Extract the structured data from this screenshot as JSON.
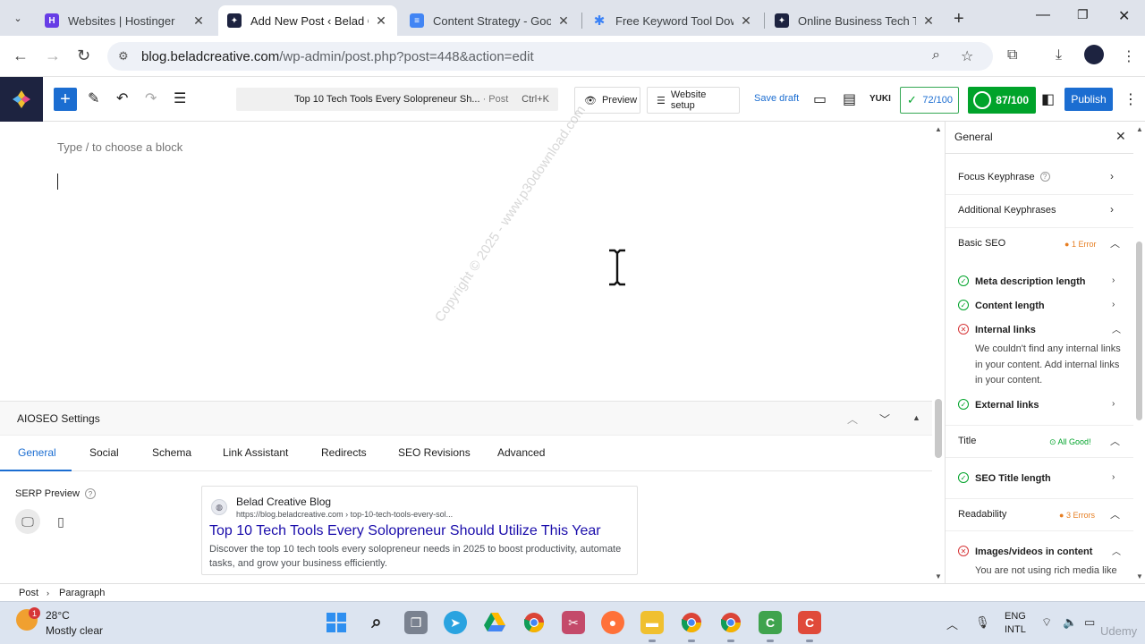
{
  "browser": {
    "tabs": [
      {
        "title": "Websites | Hostinger",
        "active": false
      },
      {
        "title": "Add New Post ‹ Belad Cr",
        "active": true
      },
      {
        "title": "Content Strategy - Googl",
        "active": false
      },
      {
        "title": "Free Keyword Tool Down",
        "active": false
      },
      {
        "title": "Online Business Tech Tre",
        "active": false
      }
    ],
    "url_host": "blog.beladcreative.com",
    "url_path": "/wp-admin/post.php?post=448&action=edit"
  },
  "toolbar": {
    "doc_title": "Top 10 Tech Tools Every Solopreneur Sh...",
    "doc_type": "· Post",
    "shortcut": "Ctrl+K",
    "preview_label": "Preview",
    "website_setup_label": "Website setup",
    "save_draft_label": "Save draft",
    "yuki_label": "YUKI",
    "score_a": "72/100",
    "score_b": "87/100",
    "publish_label": "Publish"
  },
  "editor": {
    "placeholder": "Type / to choose a block",
    "watermark": "Copyright © 2025 - www.p30download.com"
  },
  "aioseo": {
    "title": "AIOSEO Settings",
    "tabs": [
      "General",
      "Social",
      "Schema",
      "Link Assistant",
      "Redirects",
      "SEO Revisions",
      "Advanced"
    ],
    "serp_label": "SERP Preview",
    "serp": {
      "site_name": "Belad Creative Blog",
      "url": "https://blog.beladcreative.com › top-10-tech-tools-every-sol...",
      "title": "Top 10 Tech Tools Every Solopreneur Should Utilize This Year",
      "description": "Discover the top 10 tech tools every solopreneur needs in 2025 to boost productivity, automate tasks, and grow your business efficiently."
    }
  },
  "breadcrumb": {
    "post": "Post",
    "paragraph": "Paragraph"
  },
  "sidebar": {
    "title": "General",
    "focus_keyphrase": "Focus Keyphrase",
    "additional_keyphrases": "Additional Keyphrases",
    "basic_seo": {
      "label": "Basic SEO",
      "status": "1 Error"
    },
    "checks_basic": [
      {
        "label": "Meta description length",
        "state": "ok"
      },
      {
        "label": "Content length",
        "state": "ok"
      },
      {
        "label": "Internal links",
        "state": "error",
        "description": "We couldn't find any internal links in your content. Add internal links in your content."
      },
      {
        "label": "External links",
        "state": "ok"
      }
    ],
    "title_section": {
      "label": "Title",
      "status": "All Good!"
    },
    "checks_title": [
      {
        "label": "SEO Title length",
        "state": "ok"
      }
    ],
    "readability": {
      "label": "Readability",
      "status": "3 Errors"
    },
    "checks_readability": [
      {
        "label": "Images/videos in content",
        "state": "error",
        "description": "You are not using rich media like"
      }
    ],
    "colors": {
      "ok": "#00a32a",
      "error": "#d63638",
      "warn": "#e67e22"
    }
  },
  "taskbar": {
    "weather_badge": "1",
    "temperature": "28°C",
    "weather_desc": "Mostly clear",
    "lang_1": "ENG",
    "lang_2": "INTL",
    "udemy": "Udemy"
  }
}
